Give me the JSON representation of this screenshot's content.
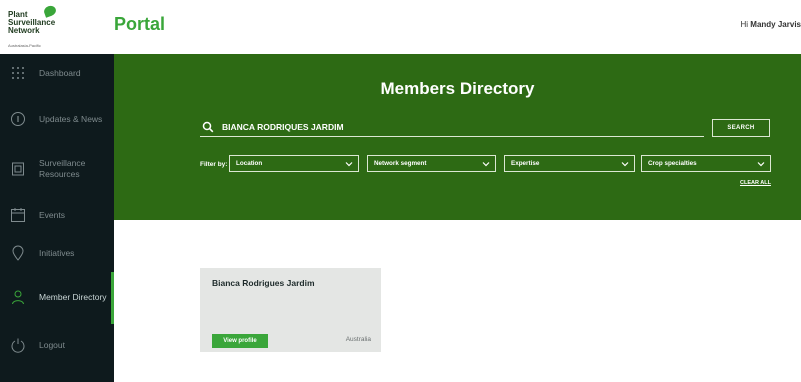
{
  "header": {
    "logo_line1": "Plant",
    "logo_line2": "Surveillance",
    "logo_line3": "Network",
    "logo_sub": "Australasia-Pacific",
    "portal": "Portal",
    "greeting_prefix": "Hi ",
    "user_name": "Mandy Jarvis"
  },
  "sidebar": {
    "items": [
      {
        "label": "Dashboard",
        "icon": "grid-dots-icon"
      },
      {
        "label": "Updates & News",
        "icon": "info-circle-icon"
      },
      {
        "label": "Surveillance Resources",
        "icon": "document-icon"
      },
      {
        "label": "Events",
        "icon": "calendar-icon"
      },
      {
        "label": "Initiatives",
        "icon": "location-pin-icon"
      },
      {
        "label": "Member Directory",
        "icon": "person-icon",
        "active": true
      },
      {
        "label": "Logout",
        "icon": "power-icon"
      }
    ]
  },
  "banner": {
    "title": "Members Directory",
    "search_value": "BIANCA RODRIQUES JARDIM",
    "search_button": "SEARCH",
    "filter_label": "Filter by:",
    "filters": [
      "Location",
      "Network segment",
      "Expertise",
      "Crop specialties"
    ],
    "clear_all": "CLEAR ALL"
  },
  "results": [
    {
      "name": "Bianca Rodrigues Jardim",
      "button": "View profile",
      "location": "Australia"
    }
  ],
  "colors": {
    "brand_green": "#3aa63a",
    "banner_green": "#2d6a14",
    "sidebar_bg": "#0e1a1d",
    "card_bg": "#e4e6e4"
  }
}
